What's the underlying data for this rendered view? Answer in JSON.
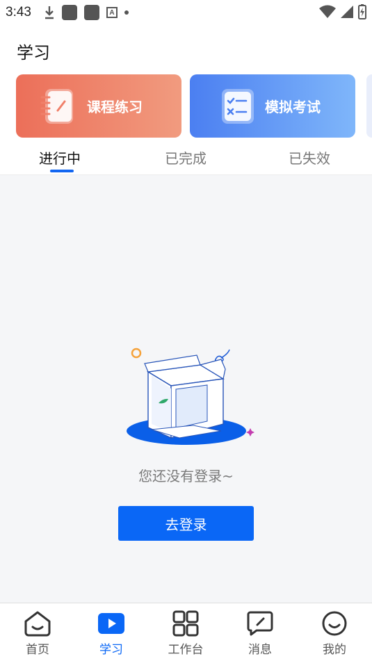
{
  "status": {
    "time": "3:43"
  },
  "header": {
    "title": "学习"
  },
  "cards": [
    {
      "label": "课程练习",
      "icon": "notebook-icon"
    },
    {
      "label": "模拟考试",
      "icon": "checklist-icon"
    }
  ],
  "tabs": [
    {
      "label": "进行中",
      "active": true
    },
    {
      "label": "已完成",
      "active": false
    },
    {
      "label": "已失效",
      "active": false
    }
  ],
  "empty": {
    "message": "您还没有登录~",
    "button": "去登录"
  },
  "nav": [
    {
      "label": "首页",
      "icon": "home-icon",
      "active": false
    },
    {
      "label": "学习",
      "icon": "play-icon",
      "active": true
    },
    {
      "label": "工作台",
      "icon": "grid-icon",
      "active": false
    },
    {
      "label": "消息",
      "icon": "message-icon",
      "active": false
    },
    {
      "label": "我的",
      "icon": "smiley-icon",
      "active": false
    }
  ],
  "colors": {
    "accent": "#0a67f6",
    "practice": "#ec6f59",
    "exam": "#4b7ff1"
  }
}
